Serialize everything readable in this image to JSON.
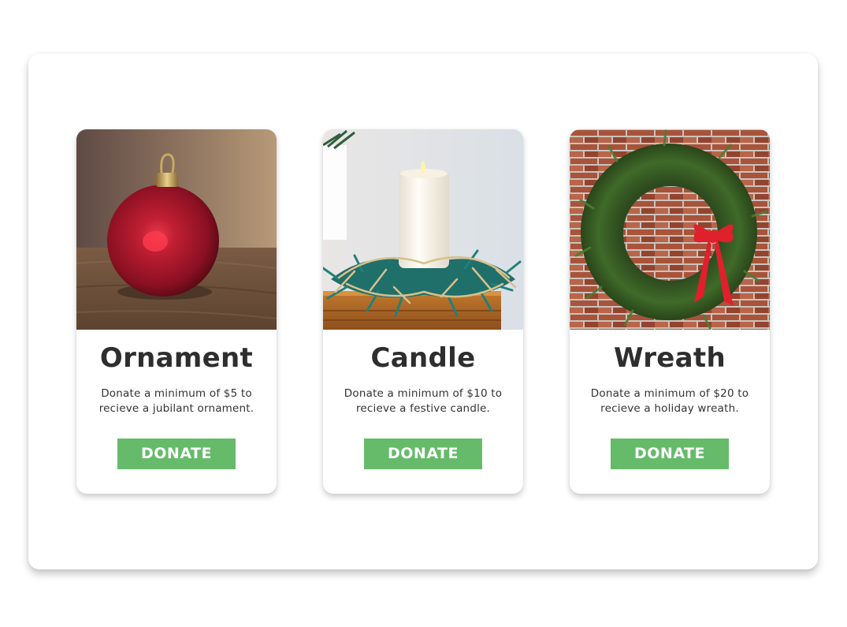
{
  "cards": [
    {
      "title": "Ornament",
      "description": "Donate a minimum of $5 to recieve a jubilant ornament.",
      "button_label": "DONATE",
      "image_subject": "red ornament ball"
    },
    {
      "title": "Candle",
      "description": "Donate a minimum of $10 to recieve a festive candle.",
      "button_label": "DONATE",
      "image_subject": "white candle with pine garland"
    },
    {
      "title": "Wreath",
      "description": "Donate a minimum of $20 to recieve a holiday wreath.",
      "button_label": "DONATE",
      "image_subject": "evergreen wreath with red bow on brick wall"
    }
  ],
  "colors": {
    "button": "#66bb6a",
    "button_text": "#ffffff",
    "title_text": "#2e2e2e",
    "body_text": "#333333"
  }
}
